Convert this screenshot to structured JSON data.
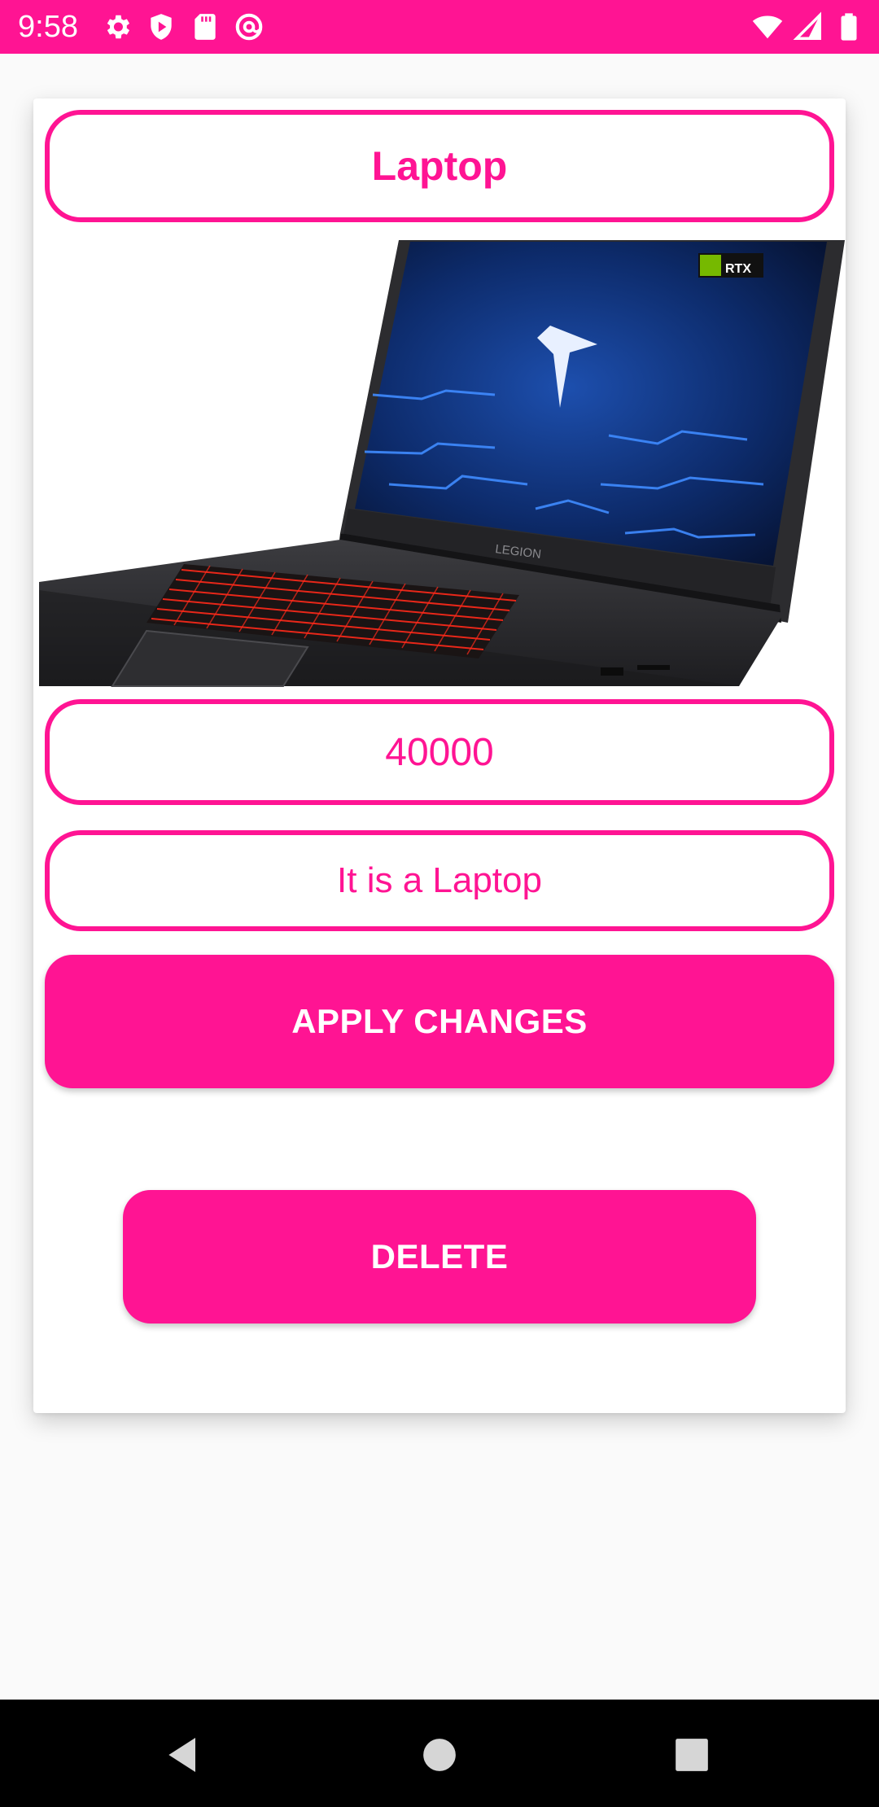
{
  "status_bar": {
    "time": "9:58",
    "background": "#ff1493",
    "left_icons": [
      "settings-icon",
      "shield-play-icon",
      "sd-card-icon",
      "at-sign-icon"
    ],
    "right_icons": [
      "wifi-icon",
      "cellular-signal-icon",
      "battery-icon"
    ]
  },
  "product": {
    "title": "Laptop",
    "price": "40000",
    "description": "It is a Laptop",
    "image": {
      "brand_bezel_text": "LEGION",
      "badge_text": "RTX"
    }
  },
  "buttons": {
    "apply_label": "APPLY CHANGES",
    "delete_label": "DELETE"
  },
  "nav_bar": {
    "icons": [
      "back-icon",
      "home-icon",
      "recents-icon"
    ]
  },
  "colors": {
    "accent": "#ff1493",
    "background": "#fafafa",
    "card": "#ffffff",
    "nav_bar": "#000000"
  }
}
